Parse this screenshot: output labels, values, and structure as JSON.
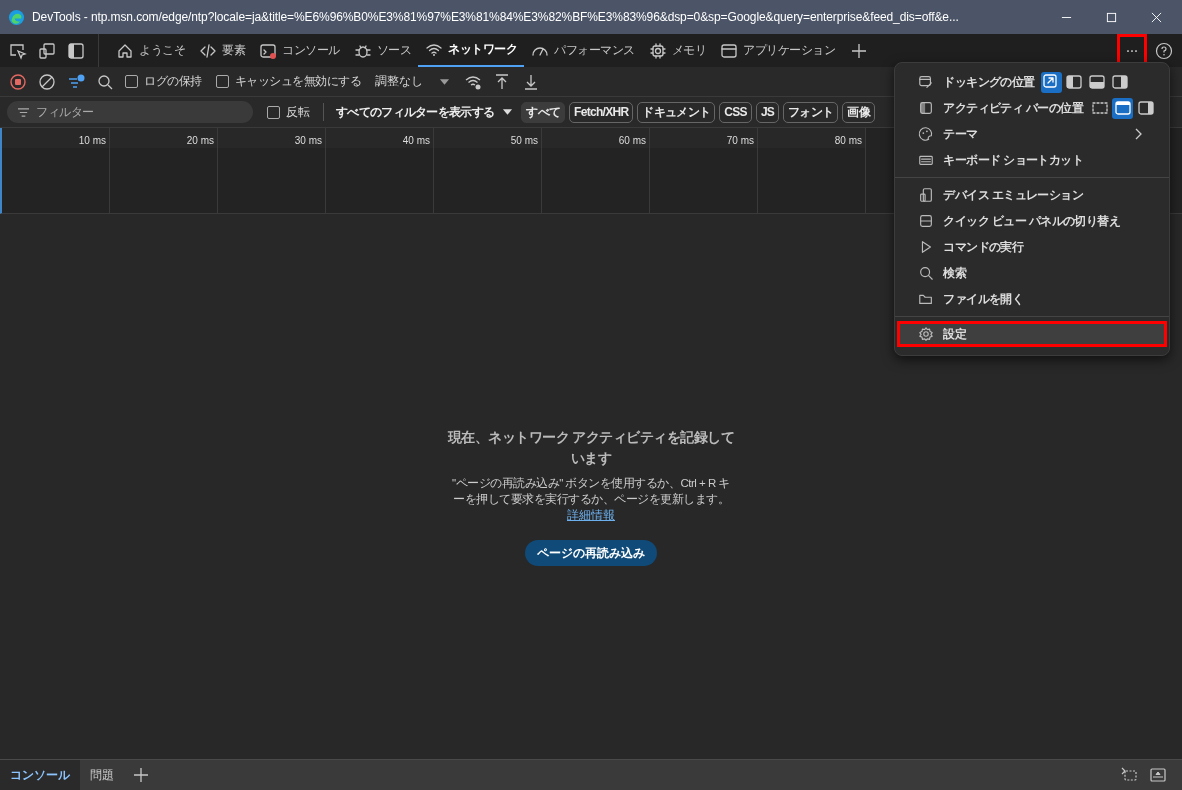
{
  "window": {
    "title": "DevTools - ntp.msn.com/edge/ntp?locale=ja&title=%E6%96%B0%E3%81%97%E3%81%84%E3%82%BF%E3%83%96&dsp=0&sp=Google&query=enterprise&feed_dis=off&e..."
  },
  "tabs": [
    {
      "label": "ようこそ",
      "selected": false
    },
    {
      "label": "要素",
      "selected": false
    },
    {
      "label": "コンソール",
      "selected": false
    },
    {
      "label": "ソース",
      "selected": false
    },
    {
      "label": "ネットワーク",
      "selected": true
    },
    {
      "label": "パフォーマンス",
      "selected": false
    },
    {
      "label": "メモリ",
      "selected": false
    },
    {
      "label": "アプリケーション",
      "selected": false
    }
  ],
  "more_tools_highlighted": true,
  "toolbar": {
    "preserve_log": {
      "label": "ログの保持",
      "checked": false
    },
    "disable_cache": {
      "label": "キャッシュを無効にする",
      "checked": false
    },
    "throttling": "調整なし"
  },
  "filter_bar": {
    "placeholder": "フィルター",
    "invert": {
      "label": "反転",
      "checked": false
    },
    "more_filters": "すべてのフィルターを表示する",
    "type_chips": [
      {
        "label": "すべて",
        "selected": true
      },
      {
        "label": "Fetch/XHR",
        "selected": false
      },
      {
        "label": "ドキュメント",
        "selected": false
      },
      {
        "label": "CSS",
        "selected": false
      },
      {
        "label": "JS",
        "selected": false
      },
      {
        "label": "フォント",
        "selected": false
      },
      {
        "label": "画像",
        "selected": false
      }
    ]
  },
  "timeline": {
    "ticks": [
      "10 ms",
      "20 ms",
      "30 ms",
      "40 ms",
      "50 ms",
      "60 ms",
      "70 ms",
      "80 ms"
    ]
  },
  "empty_state": {
    "title": "現在、ネットワーク アクティビティを記録しています",
    "body": "\"ページの再読み込み\" ボタンを使用するか、Ctrl + R キーを押して要求を実行するか、ページを更新します。",
    "link": "詳細情報",
    "button": "ページの再読み込み"
  },
  "drawer": {
    "tabs": [
      {
        "label": "コンソール",
        "selected": true
      },
      {
        "label": "問題",
        "selected": false
      }
    ]
  },
  "menu": {
    "sections": [
      [
        {
          "kind": "options",
          "label": "ドッキングの位置",
          "options": [
            {
              "selected": true
            },
            {
              "selected": false
            },
            {
              "selected": false
            },
            {
              "selected": false
            }
          ]
        },
        {
          "kind": "options",
          "label": "アクティビティ バーの位置",
          "options": [
            {
              "selected": false
            },
            {
              "selected": true
            },
            {
              "selected": false
            }
          ]
        },
        {
          "kind": "submenu",
          "label": "テーマ"
        },
        {
          "kind": "plain",
          "label": "キーボード ショートカット"
        }
      ],
      [
        {
          "kind": "plain",
          "label": "デバイス エミュレーション"
        },
        {
          "kind": "plain",
          "label": "クイック ビュー パネルの切り替え"
        },
        {
          "kind": "plain",
          "label": "コマンドの実行"
        },
        {
          "kind": "plain",
          "label": "検索"
        },
        {
          "kind": "plain",
          "label": "ファイルを開く"
        }
      ],
      [
        {
          "kind": "plain",
          "label": "設定",
          "highlighted": true
        }
      ]
    ]
  }
}
